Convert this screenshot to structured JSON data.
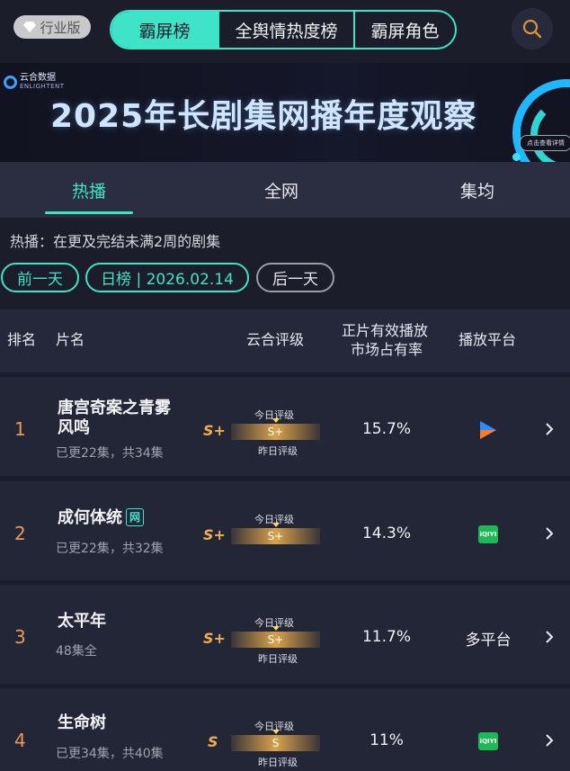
{
  "top": {
    "edition_label": "行业版",
    "tabs": [
      "霸屏榜",
      "全舆情热度榜",
      "霸屏角色"
    ]
  },
  "banner": {
    "logo_text": "云合数据",
    "logo_sub": "ENLIGHTENT",
    "headline": "2025年长剧集网播年度观察",
    "cta": "点击查看详情"
  },
  "subtabs": [
    "热播",
    "全网",
    "集均"
  ],
  "description": "热播：在更及完结未满2周的剧集",
  "date_nav": {
    "prev": "前一天",
    "current": "日榜 | 2026.02.14",
    "next": "后一天"
  },
  "table": {
    "headers": {
      "rank": "排名",
      "title": "片名",
      "rating": "云合评级",
      "share_line1": "正片有效播放",
      "share_line2": "市场占有率",
      "platform": "播放平台"
    },
    "today_label": "今日评级",
    "yesterday_label": "昨日评级",
    "rows": [
      {
        "rank": "1",
        "title": "唐宫奇案之青雾风鸣",
        "meta": "已更22集，共34集",
        "grade": "S+",
        "today": "S+",
        "share": "15.7%",
        "platform": "youku-icon",
        "platform_text": ""
      },
      {
        "rank": "2",
        "title": "成何体统",
        "badge": "网",
        "meta": "已更22集，共32集",
        "grade": "S+",
        "today": "S+",
        "share": "14.3%",
        "platform": "iqiyi-icon",
        "platform_text": "iQIYI"
      },
      {
        "rank": "3",
        "title": "太平年",
        "meta": "48集全",
        "grade": "S+",
        "today": "S+",
        "share": "11.7%",
        "platform": "multi",
        "platform_text": "多平台"
      },
      {
        "rank": "4",
        "title": "生命树",
        "meta": "已更34集，共40集",
        "grade": "S",
        "today": "S",
        "share": "11%",
        "platform": "iqiyi-icon",
        "platform_text": "iQIYI"
      }
    ]
  },
  "colors": {
    "accent": "#3fe3c7",
    "rank": "#e89a5a",
    "grade": "#f3ad4a",
    "background": "#1b1d2b"
  }
}
